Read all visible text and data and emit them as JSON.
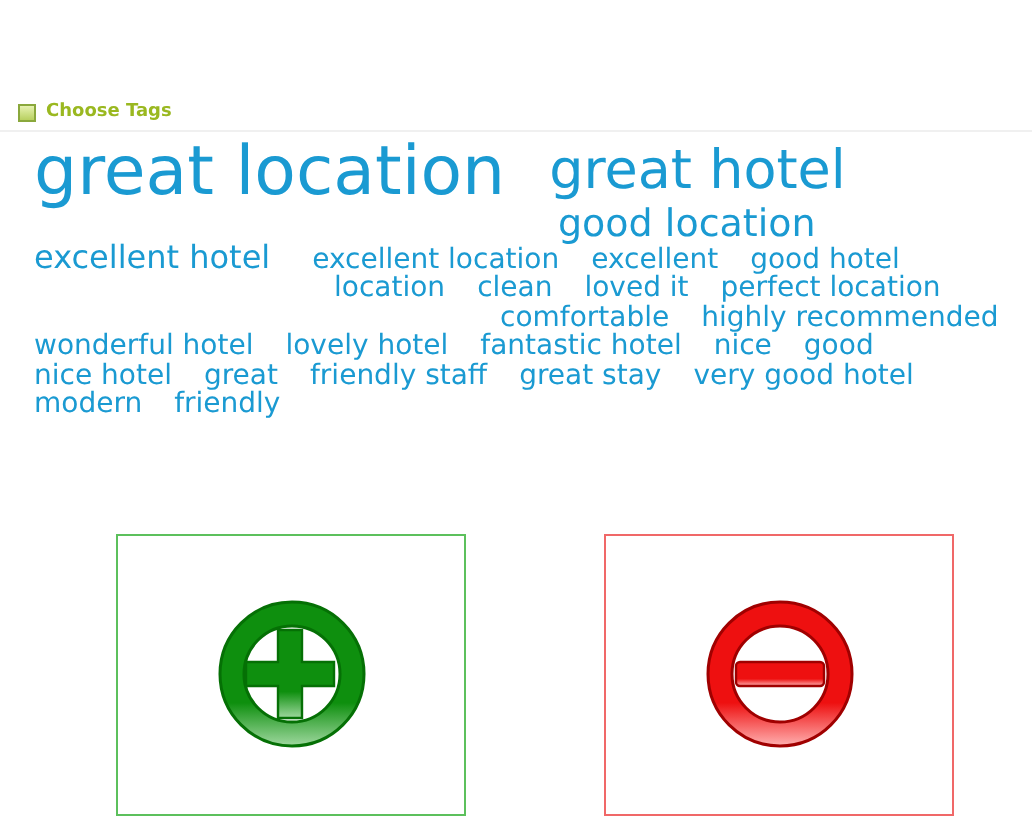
{
  "header": {
    "title": "Choose Tags"
  },
  "tag_rows": [
    [
      {
        "label": "great location",
        "kind": "xl"
      },
      {
        "label": "great hotel",
        "kind": "lg"
      }
    ],
    [
      {
        "label": "good location",
        "kind": "md"
      }
    ],
    [
      {
        "label": "excellent hotel",
        "kind": "sm"
      },
      {
        "label": "excellent location",
        "kind": "xs"
      },
      {
        "label": "excellent",
        "kind": "xs"
      },
      {
        "label": "good hotel",
        "kind": "xs"
      }
    ],
    [
      {
        "label": "location",
        "kind": "xs"
      },
      {
        "label": "clean",
        "kind": "xs"
      },
      {
        "label": "loved it",
        "kind": "xs"
      },
      {
        "label": "perfect location",
        "kind": "xs"
      }
    ],
    [
      {
        "label": "comfortable",
        "kind": "xs"
      },
      {
        "label": "highly recommended",
        "kind": "xs"
      }
    ],
    [
      {
        "label": "wonderful hotel",
        "kind": "xs"
      },
      {
        "label": "lovely hotel",
        "kind": "xs"
      },
      {
        "label": "fantastic hotel",
        "kind": "xs"
      },
      {
        "label": "nice",
        "kind": "xs"
      },
      {
        "label": "good",
        "kind": "xs"
      }
    ],
    [
      {
        "label": "nice hotel",
        "kind": "xs"
      },
      {
        "label": "great",
        "kind": "xs"
      },
      {
        "label": "friendly staff",
        "kind": "xs"
      },
      {
        "label": "great stay",
        "kind": "xs"
      },
      {
        "label": "very good hotel",
        "kind": "xs"
      }
    ],
    [
      {
        "label": "modern",
        "kind": "xs"
      },
      {
        "label": "friendly",
        "kind": "xs"
      }
    ]
  ],
  "actions": [
    {
      "kind": "add"
    },
    {
      "kind": "remove"
    }
  ]
}
